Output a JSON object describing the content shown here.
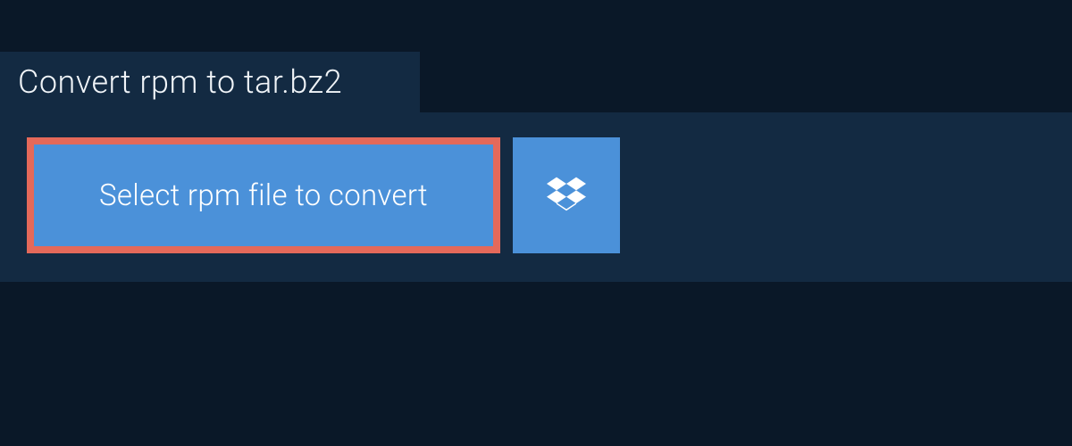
{
  "header": {
    "title": "Convert rpm to tar.bz2"
  },
  "actions": {
    "select_file_label": "Select rpm file to convert",
    "dropbox_icon": "dropbox"
  },
  "colors": {
    "background": "#0a1828",
    "panel": "#132a42",
    "button_primary": "#4b91d9",
    "button_highlight_border": "#e4695a",
    "text_light": "#ffffff"
  }
}
